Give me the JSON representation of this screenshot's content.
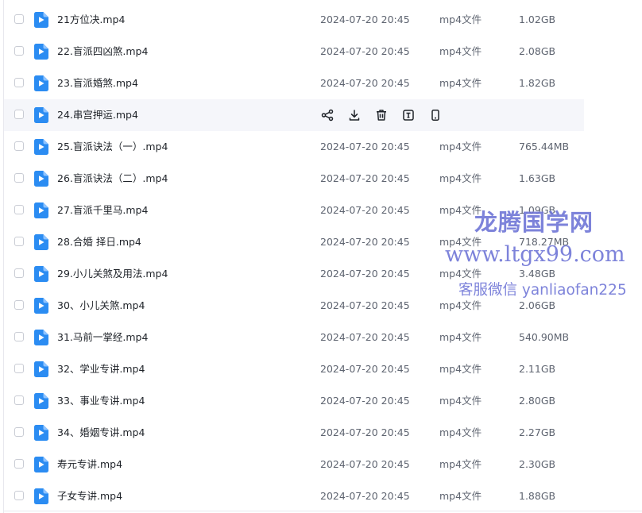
{
  "colors": {
    "accent": "#2b8cf2",
    "watermark": "#6c72d6",
    "row_hover": "#f5f6fa"
  },
  "row_actions": [
    {
      "icon": "share-icon"
    },
    {
      "icon": "download-icon"
    },
    {
      "icon": "trash-icon"
    },
    {
      "icon": "rename-icon"
    },
    {
      "icon": "mobile-icon"
    }
  ],
  "files": [
    {
      "name": "21方位决.mp4",
      "date": "2024-07-20 20:45",
      "type": "mp4文件",
      "size": "1.02GB"
    },
    {
      "name": "22.盲派四凶煞.mp4",
      "date": "2024-07-20 20:45",
      "type": "mp4文件",
      "size": "2.08GB"
    },
    {
      "name": "23.盲派婚煞.mp4",
      "date": "2024-07-20 20:45",
      "type": "mp4文件",
      "size": "1.82GB"
    },
    {
      "name": "24.串宫押运.mp4",
      "date": "",
      "type": "",
      "size": "",
      "hovered": true
    },
    {
      "name": "25.盲派诀法（一）.mp4",
      "date": "2024-07-20 20:45",
      "type": "mp4文件",
      "size": "765.44MB"
    },
    {
      "name": "26.盲派诀法（二）.mp4",
      "date": "2024-07-20 20:45",
      "type": "mp4文件",
      "size": "1.63GB"
    },
    {
      "name": "27.盲派千里马.mp4",
      "date": "2024-07-20 20:45",
      "type": "mp4文件",
      "size": "1.09GB"
    },
    {
      "name": "28.合婚 择日.mp4",
      "date": "2024-07-20 20:45",
      "type": "mp4文件",
      "size": "718.27MB"
    },
    {
      "name": "29.小儿关煞及用法.mp4",
      "date": "2024-07-20 20:45",
      "type": "mp4文件",
      "size": "3.48GB"
    },
    {
      "name": "30、小儿关煞.mp4",
      "date": "2024-07-20 20:45",
      "type": "mp4文件",
      "size": "2.06GB"
    },
    {
      "name": "31.马前一掌经.mp4",
      "date": "2024-07-20 20:45",
      "type": "mp4文件",
      "size": "540.90MB"
    },
    {
      "name": "32、学业专讲.mp4",
      "date": "2024-07-20 20:45",
      "type": "mp4文件",
      "size": "2.11GB"
    },
    {
      "name": "33、事业专讲.mp4",
      "date": "2024-07-20 20:45",
      "type": "mp4文件",
      "size": "2.80GB"
    },
    {
      "name": "34、婚姻专讲.mp4",
      "date": "2024-07-20 20:45",
      "type": "mp4文件",
      "size": "2.27GB"
    },
    {
      "name": "寿元专讲.mp4",
      "date": "2024-07-20 20:45",
      "type": "mp4文件",
      "size": "2.30GB"
    },
    {
      "name": "子女专讲.mp4",
      "date": "2024-07-20 20:45",
      "type": "mp4文件",
      "size": "1.88GB"
    }
  ],
  "watermark": {
    "title": "龙腾国学网",
    "url": "www.ltgx99.com",
    "contact": "客服微信 yanliaofan225"
  }
}
